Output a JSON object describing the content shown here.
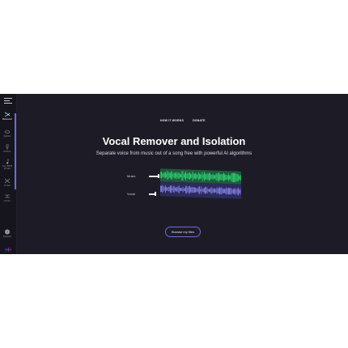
{
  "sidebar": {
    "items": [
      {
        "label": "Remover",
        "icon": "scissors-icon"
      },
      {
        "label": "Splitter",
        "icon": "split-icon"
      },
      {
        "label": "Pitcher",
        "icon": "tuning-fork-icon"
      },
      {
        "label": "Key BPM Finder",
        "icon": "music-note-icon"
      },
      {
        "label": "Cutter",
        "icon": "cut-icon"
      },
      {
        "label": "Joiner",
        "icon": "join-icon"
      }
    ],
    "support_label": "Support",
    "language": "English"
  },
  "nav": {
    "how_it_works": "HOW IT WORKS",
    "donate": "DONATE"
  },
  "hero": {
    "title": "Vocal Remover and Isolation",
    "subtitle": "Separate voice from music out of a song free with powerful AI algorithms"
  },
  "demo": {
    "tracks": [
      {
        "label": "Music",
        "color": "#2fd874"
      },
      {
        "label": "Vocal",
        "color": "#6e6bd9"
      }
    ]
  },
  "cta": {
    "browse_label": "Browse my files"
  },
  "colors": {
    "background": "#1d1c26",
    "accent": "#6e6bd9",
    "green": "#2fd874"
  }
}
